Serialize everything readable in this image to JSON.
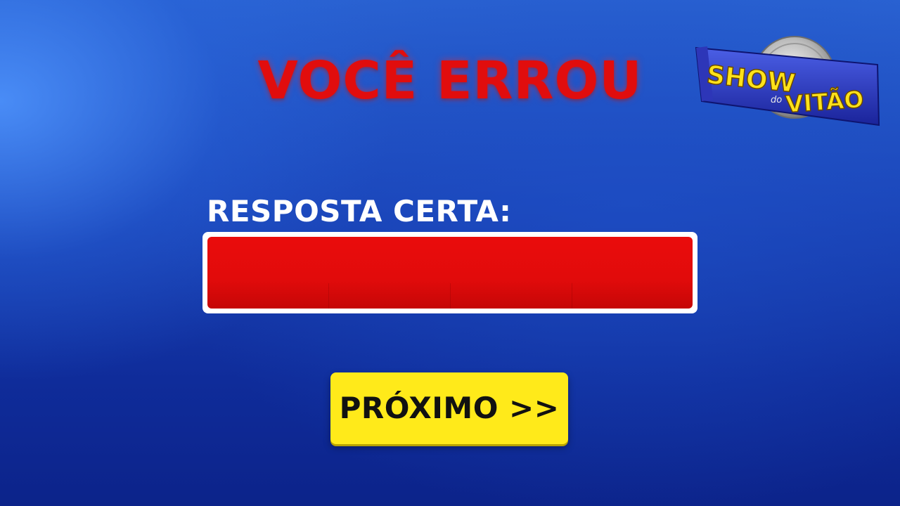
{
  "headline": "VOCÊ ERROU",
  "answer": {
    "label": "RESPOSTA CERTA:",
    "value": ""
  },
  "next_button": {
    "label": "PRÓXIMO >>"
  },
  "logo": {
    "word_top": "SHOW",
    "word_small": "do",
    "word_bottom": "VITÃO",
    "icon": "bitcoin-coin-icon"
  },
  "colors": {
    "background_top": "#2a63d2",
    "background_bottom": "#0c238a",
    "headline": "#e10d0d",
    "answer_fill": "#e10b0b",
    "button": "#ffea1a"
  }
}
